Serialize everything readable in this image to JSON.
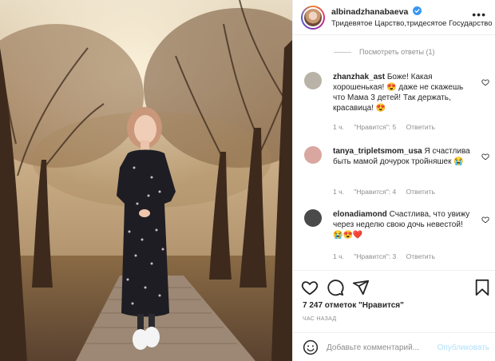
{
  "post": {
    "username": "albinadzhanabaeva",
    "location": "Тридевятое Царство,тридесятое Государство",
    "more_icon": "ellipsis-icon"
  },
  "replies": {
    "view_label": "Посмотреть ответы (1)"
  },
  "comments": [
    {
      "user": "zhanzhak_ast",
      "text": "Боже! Какая хорошенькая! 😍 даже не скажешь что Мама 3 детей! Так держать, красавица! 😍",
      "time": "1 ч.",
      "likes": "\"Нравится\": 5",
      "reply": "Ответить",
      "avatar_color": "#b9b2a6"
    },
    {
      "user": "tanya_tripletsmom_usa",
      "text": "Я счастлива быть мамой дочурок тройняшек 😭",
      "time": "1 ч.",
      "likes": "\"Нравится\": 4",
      "reply": "Ответить",
      "avatar_color": "#d9a7a0"
    },
    {
      "user": "elonadiamond",
      "text": "Счастлива, что увижу через неделю свою дочь невестой! 😭😍❤️",
      "time": "1 ч.",
      "likes": "\"Нравится\": 3",
      "reply": "Ответить",
      "avatar_color": "#4a4a4a"
    }
  ],
  "stats": {
    "likes_label": "7 247 отметок \"Нравится\"",
    "time_label": "ЧАС НАЗАД"
  },
  "compose": {
    "placeholder": "Добавьте комментарий...",
    "publish_label": "Опубликовать"
  },
  "colors": {
    "accent": "#0095f6",
    "verified": "#3897f0",
    "muted": "#8e8e8e",
    "heart": "#ed4956"
  }
}
